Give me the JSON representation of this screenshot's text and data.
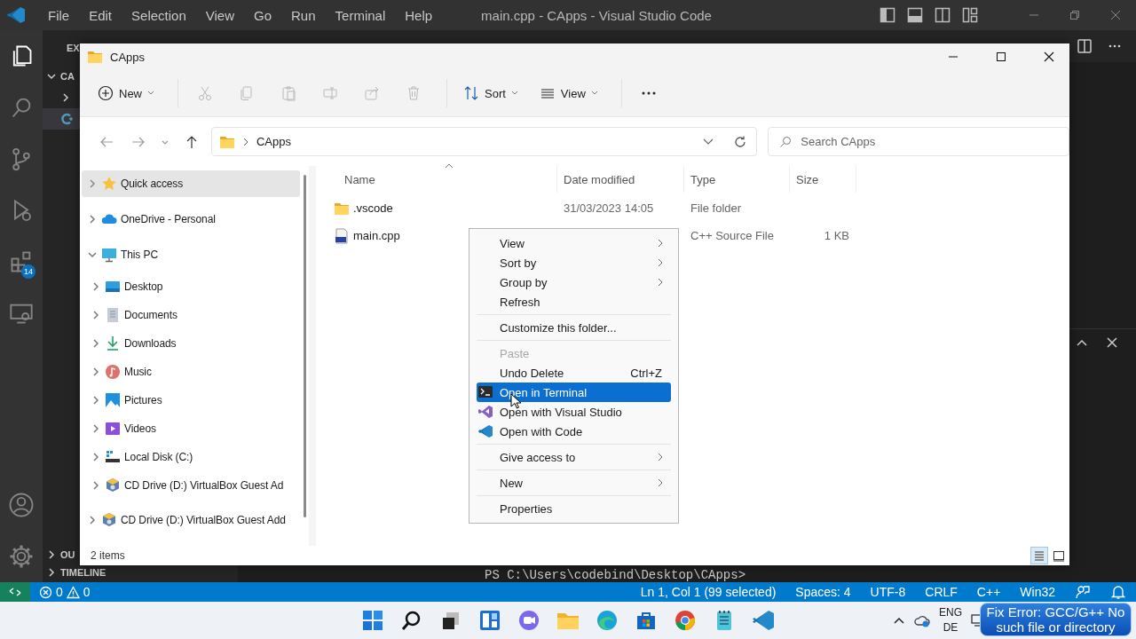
{
  "vscode": {
    "menu": [
      "File",
      "Edit",
      "Selection",
      "View",
      "Go",
      "Run",
      "Terminal",
      "Help"
    ],
    "title": "main.cpp - CApps - Visual Studio Code",
    "activity_bar": [
      {
        "selected": true
      },
      {
        "selected": false
      },
      {
        "selected": false
      },
      {
        "selected": false
      },
      {
        "selected": false,
        "badge": "14"
      },
      {
        "selected": false
      }
    ],
    "sidebar": {
      "header": "EX",
      "folder": "CA",
      "outline": "OU",
      "timeline": "TIMELINE"
    },
    "terminal_line": "PS C:\\Users\\codebind\\Desktop\\CApps>",
    "status_bar": {
      "errors": "0",
      "warnings": "0",
      "items": [
        "Ln 1, Col 1 (99 selected)",
        "Spaces: 4",
        "UTF-8",
        "CRLF",
        "C++",
        "Win32"
      ]
    }
  },
  "file_explorer": {
    "title": "CApps",
    "toolbar": [
      {
        "label": "New",
        "dropdown": true,
        "disabled": false
      },
      {
        "disabled": true
      },
      {
        "disabled": true
      },
      {
        "disabled": true
      },
      {
        "disabled": true
      },
      {
        "disabled": true
      },
      {
        "disabled": true
      },
      {
        "label": "Sort",
        "dropdown": true,
        "disabled": false
      },
      {
        "label": "View",
        "dropdown": true,
        "disabled": false
      },
      {
        "disabled": false
      }
    ],
    "path": [
      "CApps"
    ],
    "search_placeholder": "Search CApps",
    "navigation": [
      {
        "label": "Quick access",
        "selected": true,
        "expanded": false
      },
      {
        "label": "OneDrive - Personal",
        "selected": false,
        "expanded": false
      },
      {
        "label": "This PC",
        "selected": false,
        "expanded": true,
        "children": [
          {
            "label": "Desktop",
            "selected": false,
            "expanded": false
          },
          {
            "label": "Documents",
            "selected": false,
            "expanded": false
          },
          {
            "label": "Downloads",
            "selected": false,
            "expanded": false
          },
          {
            "label": "Music",
            "selected": false,
            "expanded": false
          },
          {
            "label": "Pictures",
            "selected": false,
            "expanded": false
          },
          {
            "label": "Videos",
            "selected": false,
            "expanded": false
          },
          {
            "label": "Local Disk (C:)",
            "selected": false,
            "expanded": false
          },
          {
            "label": "CD Drive (D:) VirtualBox Guest Ad",
            "selected": false,
            "expanded": false
          }
        ]
      },
      {
        "label": "CD Drive (D:) VirtualBox Guest Add",
        "selected": false,
        "expanded": false
      }
    ],
    "columns": [
      {
        "label": "Name",
        "sorted": true
      },
      {
        "label": "Date modified",
        "sorted": false
      },
      {
        "label": "Type",
        "sorted": false
      },
      {
        "label": "Size",
        "sorted": false
      }
    ],
    "files": [
      {
        "kind": "folder",
        "name": ".vscode",
        "date": "31/03/2023 14:05",
        "type": "File folder"
      },
      {
        "kind": "file",
        "name": "main.cpp",
        "type": "C++ Source File",
        "size": "1 KB"
      }
    ],
    "status": "2 items",
    "view_buttons": [
      {
        "selected": true
      },
      {
        "selected": false
      }
    ]
  },
  "context_menu": [
    {
      "kind": "item",
      "label": "View",
      "submenu": true,
      "selected": false,
      "disabled": false
    },
    {
      "kind": "item",
      "label": "Sort by",
      "submenu": true,
      "selected": false,
      "disabled": false
    },
    {
      "kind": "item",
      "label": "Group by",
      "submenu": true,
      "selected": false,
      "disabled": false
    },
    {
      "kind": "item",
      "label": "Refresh",
      "submenu": false,
      "selected": false,
      "disabled": false
    },
    {
      "kind": "separator"
    },
    {
      "kind": "item",
      "label": "Customize this folder...",
      "submenu": false,
      "selected": false,
      "disabled": false
    },
    {
      "kind": "separator"
    },
    {
      "kind": "item",
      "label": "Paste",
      "submenu": false,
      "selected": false,
      "disabled": true
    },
    {
      "kind": "item",
      "label": "Undo Delete",
      "shortcut": "Ctrl+Z",
      "submenu": false,
      "selected": false,
      "disabled": false
    },
    {
      "kind": "item",
      "label": "Open in Terminal",
      "submenu": false,
      "selected": true,
      "disabled": false
    },
    {
      "kind": "item",
      "label": "Open with Visual Studio",
      "submenu": false,
      "selected": false,
      "disabled": false
    },
    {
      "kind": "item",
      "label": "Open with Code",
      "submenu": false,
      "selected": false,
      "disabled": false
    },
    {
      "kind": "separator"
    },
    {
      "kind": "item",
      "label": "Give access to",
      "submenu": true,
      "selected": false,
      "disabled": false
    },
    {
      "kind": "separator"
    },
    {
      "kind": "item",
      "label": "New",
      "submenu": true,
      "selected": false,
      "disabled": false
    },
    {
      "kind": "separator"
    },
    {
      "kind": "item",
      "label": "Properties",
      "submenu": false,
      "selected": false,
      "disabled": false
    }
  ],
  "taskbar": {
    "language": [
      "ENG",
      "DE"
    ]
  },
  "overlay_caption": "Fix Error: GCC/G++ No such file or directory"
}
